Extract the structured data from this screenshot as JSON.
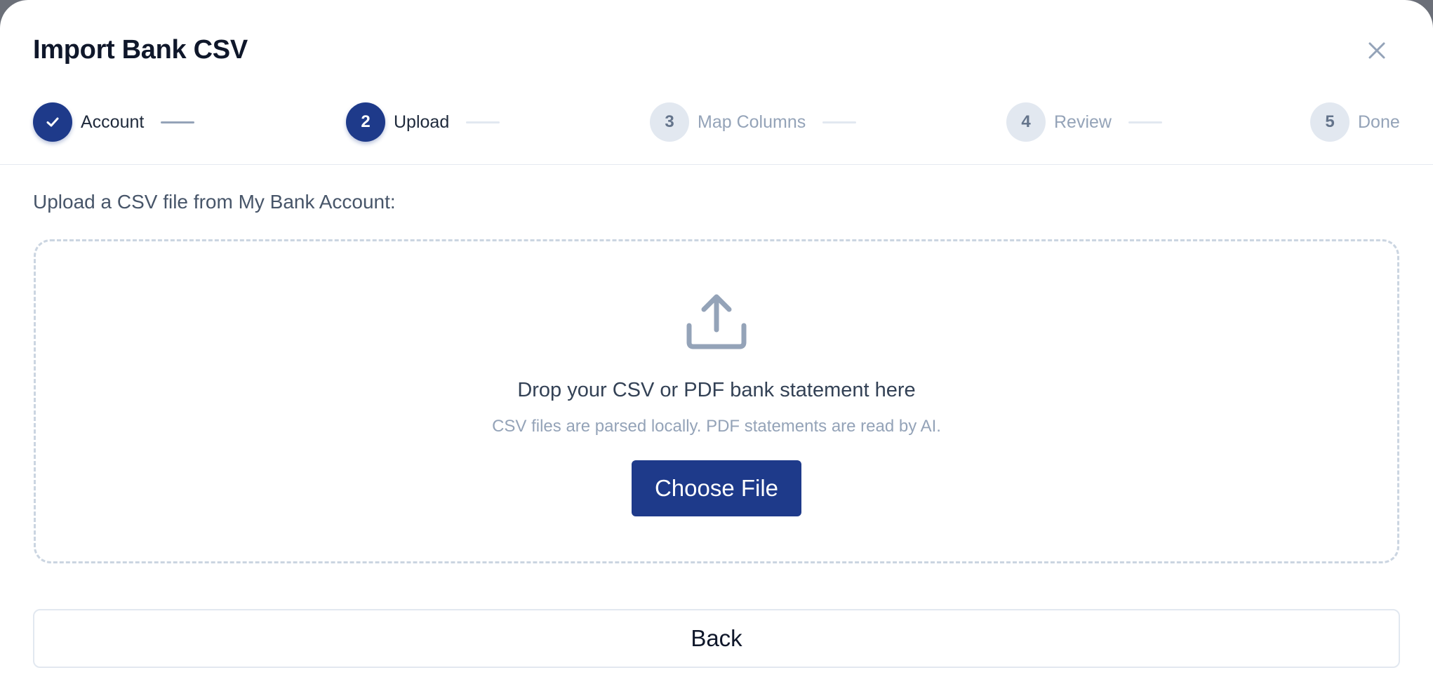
{
  "dialog": {
    "title": "Import Bank CSV",
    "close_icon": "close-icon"
  },
  "stepper": {
    "steps": [
      {
        "number": "1",
        "label": "Account",
        "status": "done",
        "icon": "check-icon"
      },
      {
        "number": "2",
        "label": "Upload",
        "status": "active"
      },
      {
        "number": "3",
        "label": "Map Columns",
        "status": "pending"
      },
      {
        "number": "4",
        "label": "Review",
        "status": "pending"
      },
      {
        "number": "5",
        "label": "Done",
        "status": "pending"
      }
    ]
  },
  "upload": {
    "instruction": "Upload a CSV file from My Bank Account:",
    "icon": "upload-icon",
    "drop_title": "Drop your CSV or PDF bank statement here",
    "drop_subtitle": "CSV files are parsed locally. PDF statements are read by AI.",
    "choose_button": "Choose File"
  },
  "footer": {
    "back_button": "Back"
  },
  "colors": {
    "primary": "#1e3a8a",
    "muted": "#94a3b8",
    "pending_circle": "#e2e8f0",
    "dropzone_border": "#cbd5e1"
  }
}
